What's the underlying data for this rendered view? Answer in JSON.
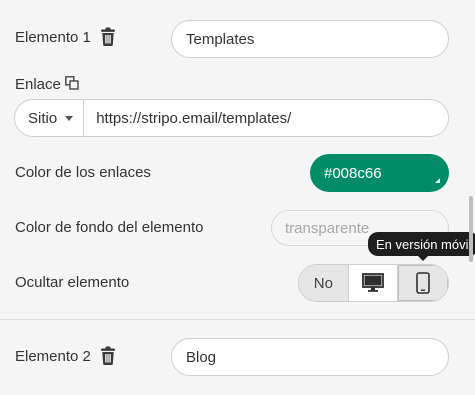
{
  "element1": {
    "label": "Elemento 1",
    "icon": "trash-icon",
    "value": "Templates"
  },
  "link": {
    "label": "Enlace",
    "icon": "link-copy-icon",
    "select_value": "Sitio",
    "url": "https://stripo.email/templates/"
  },
  "link_color": {
    "label": "Color de los enlaces",
    "value": "#008c66",
    "color": "#008c66"
  },
  "bg_color": {
    "label": "Color de fondo del elemento",
    "placeholder": "transparente"
  },
  "hide": {
    "label": "Ocultar elemento",
    "options": [
      {
        "label": "No",
        "icon": null
      },
      {
        "label": "",
        "icon": "desktop-icon"
      },
      {
        "label": "",
        "icon": "mobile-icon"
      }
    ],
    "tooltip": "En versión móvil"
  },
  "element2": {
    "label": "Elemento 2",
    "icon": "trash-icon",
    "value": "Blog"
  }
}
